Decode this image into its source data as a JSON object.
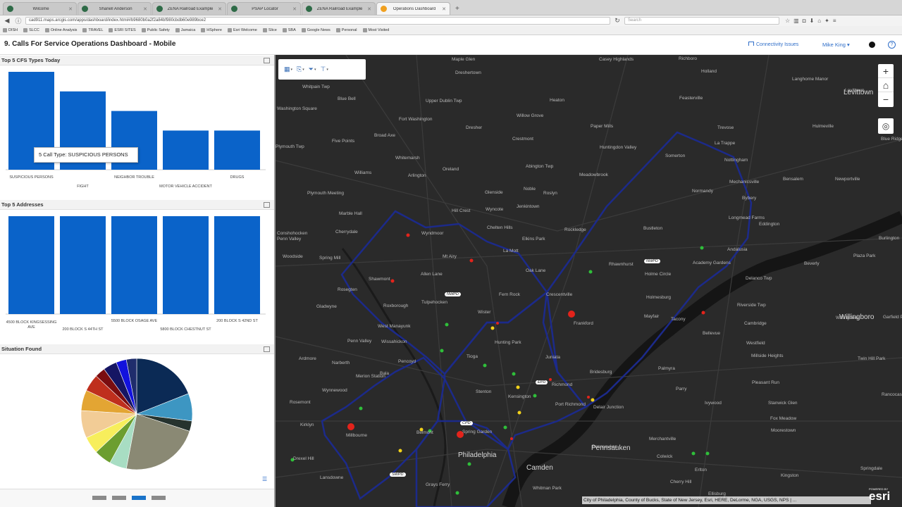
{
  "browser": {
    "tabs": [
      {
        "label": "Wilcome",
        "active": false
      },
      {
        "label": "Shanell Anderson",
        "active": false
      },
      {
        "label": "ZENA Railroad Example",
        "active": false
      },
      {
        "label": "PSAP Locator",
        "active": false
      },
      {
        "label": "ZENA Railroad Example",
        "active": false
      },
      {
        "label": "Operations Dashboard",
        "active": true
      }
    ],
    "url": "cad911.maps.arcgis.com/apps/dashboard/index.html#/b9680b0a2f2a84bf980cbdb60e989bce2",
    "search_placeholder": "Search",
    "bookmarks": [
      "DISH",
      "SLCC",
      "Online Analysis",
      "TRAVEL",
      "ESRI SITES",
      "Public Safety",
      "Jamaica",
      "HSphere",
      "Esri Welcome",
      "Slice",
      "SBA",
      "Google News",
      "Personal",
      "Most Visited"
    ]
  },
  "app": {
    "title": "9. Calls For Service Operations Dashboard - Mobile",
    "connectivity": "Connectivity Issues",
    "user": "Mike King",
    "help": "?"
  },
  "panels": {
    "cfs": {
      "title": "Top 5 CFS Types Today",
      "tooltip": "5 Call Type: SUSPICIOUS PERSONS"
    },
    "addresses": {
      "title": "Top 5 Addresses"
    },
    "situation": {
      "title": "Situation Found"
    }
  },
  "chart_data": [
    {
      "type": "bar",
      "title": "Top 5 CFS Types Today",
      "categories": [
        "SUSPICIOUS PERSONS",
        "FIGHT",
        "NEIGHBOR TROUBLE",
        "MOTOR VEHICLE ACCIDENT",
        "DRUGS"
      ],
      "values": [
        5,
        4,
        3,
        2,
        2
      ],
      "ylim": [
        0,
        5
      ],
      "color": "#0a63c9"
    },
    {
      "type": "bar",
      "title": "Top 5 Addresses",
      "categories": [
        "4500 BLOCK KINGSESSING AVE",
        "200 BLOCK S 44TH ST",
        "5500 BLOCK OSAGE AVE",
        "5800 BLOCK CHESTNUT ST",
        "200 BLOCK S 42ND ST"
      ],
      "values": [
        1,
        1,
        1,
        1,
        1
      ],
      "ylim": [
        0,
        1
      ],
      "color": "#0a63c9"
    },
    {
      "type": "pie",
      "title": "Situation Found",
      "values": [
        19,
        8,
        3,
        23,
        5,
        5,
        5,
        8,
        6,
        5,
        3,
        4,
        3,
        3
      ],
      "colors": [
        "#0b2a55",
        "#3d96c2",
        "#26332e",
        "#8a8974",
        "#a8ddc3",
        "#6c9e2f",
        "#f7ee5c",
        "#f2cc96",
        "#e3a533",
        "#bf2f1d",
        "#7a0d10",
        "#151563",
        "#1212dd",
        "#1f2d6c"
      ]
    }
  ],
  "map": {
    "places": [
      {
        "t": "Maple Glen",
        "x": 250,
        "y": 3
      },
      {
        "t": "Upper Dublin Twp",
        "x": 213,
        "y": 62
      },
      {
        "t": "Fort Washington",
        "x": 175,
        "y": 88
      },
      {
        "t": "Dresher",
        "x": 270,
        "y": 100
      },
      {
        "t": "Willow Grove",
        "x": 342,
        "y": 83
      },
      {
        "t": "Heaton",
        "x": 389,
        "y": 61
      },
      {
        "t": "Whitemarsh",
        "x": 170,
        "y": 143
      },
      {
        "t": "Arlington",
        "x": 188,
        "y": 168
      },
      {
        "t": "Oreland",
        "x": 237,
        "y": 159
      },
      {
        "t": "Crestmont",
        "x": 336,
        "y": 116
      },
      {
        "t": "Abington Twp",
        "x": 355,
        "y": 155
      },
      {
        "t": "Meadowbrook",
        "x": 431,
        "y": 167
      },
      {
        "t": "Roslyn",
        "x": 380,
        "y": 193
      },
      {
        "t": "Noble",
        "x": 352,
        "y": 187
      },
      {
        "t": "Glenside",
        "x": 297,
        "y": 192
      },
      {
        "t": "Wyncote",
        "x": 298,
        "y": 216
      },
      {
        "t": "Jenkintown",
        "x": 342,
        "y": 212
      },
      {
        "t": "Rockledge",
        "x": 410,
        "y": 245
      },
      {
        "t": "Elkins Park",
        "x": 350,
        "y": 258
      },
      {
        "t": "Chelten Hills",
        "x": 300,
        "y": 242
      },
      {
        "t": "La Mott",
        "x": 323,
        "y": 275
      },
      {
        "t": "Oak Lane",
        "x": 355,
        "y": 303
      },
      {
        "t": "Hill Crest",
        "x": 250,
        "y": 218
      },
      {
        "t": "Wyndmoor",
        "x": 207,
        "y": 250
      },
      {
        "t": "Mt Airy",
        "x": 237,
        "y": 283
      },
      {
        "t": "Allen Lane",
        "x": 206,
        "y": 308
      },
      {
        "t": "Shawmont",
        "x": 132,
        "y": 315
      },
      {
        "t": "Roxborough",
        "x": 153,
        "y": 353
      },
      {
        "t": "Tulpehocken",
        "x": 207,
        "y": 348
      },
      {
        "t": "Fern Rock",
        "x": 317,
        "y": 337
      },
      {
        "t": "Crescentville",
        "x": 384,
        "y": 337
      },
      {
        "t": "Wister",
        "x": 287,
        "y": 362
      },
      {
        "t": "Frankford",
        "x": 423,
        "y": 378
      },
      {
        "t": "Hunting Park",
        "x": 311,
        "y": 405
      },
      {
        "t": "Tioga",
        "x": 271,
        "y": 425
      },
      {
        "t": "Juniata",
        "x": 383,
        "y": 426
      },
      {
        "t": "Kensington",
        "x": 330,
        "y": 482
      },
      {
        "t": "Richmond",
        "x": 392,
        "y": 465
      },
      {
        "t": "Port Richmond",
        "x": 397,
        "y": 493
      },
      {
        "t": "Delair Junction",
        "x": 451,
        "y": 497
      },
      {
        "t": "Stenton",
        "x": 284,
        "y": 475
      },
      {
        "t": "Spring Garden",
        "x": 265,
        "y": 532
      },
      {
        "t": "Belmont",
        "x": 200,
        "y": 533
      },
      {
        "t": "Wissahickon",
        "x": 150,
        "y": 404
      },
      {
        "t": "Pencoyd",
        "x": 174,
        "y": 432
      },
      {
        "t": "West Manayunk",
        "x": 145,
        "y": 382
      },
      {
        "t": "Bala",
        "x": 148,
        "y": 449
      },
      {
        "t": "Narberth",
        "x": 80,
        "y": 434
      },
      {
        "t": "Merion Station",
        "x": 114,
        "y": 453
      },
      {
        "t": "Wynnewood",
        "x": 66,
        "y": 473
      },
      {
        "t": "Penn Valley",
        "x": 102,
        "y": 403
      },
      {
        "t": "Ardmore",
        "x": 33,
        "y": 428
      },
      {
        "t": "Gladwyne",
        "x": 58,
        "y": 354
      },
      {
        "t": "Rosemont",
        "x": 20,
        "y": 490
      },
      {
        "t": "Kirklyn",
        "x": 35,
        "y": 522
      },
      {
        "t": "Millbourne",
        "x": 100,
        "y": 537
      },
      {
        "t": "Drexel Hill",
        "x": 25,
        "y": 570
      },
      {
        "t": "Lansdowne",
        "x": 63,
        "y": 597
      },
      {
        "t": "Grays Ferry",
        "x": 213,
        "y": 607
      },
      {
        "t": "Whitman Park",
        "x": 365,
        "y": 612
      },
      {
        "t": "Spring Mill",
        "x": 62,
        "y": 285
      },
      {
        "t": "Rosegten",
        "x": 88,
        "y": 330
      },
      {
        "t": "Conshohocken",
        "x": 2,
        "y": 250
      },
      {
        "t": "Cherrydale",
        "x": 85,
        "y": 248
      },
      {
        "t": "Marble Hall",
        "x": 90,
        "y": 222
      },
      {
        "t": "Plymouth Meeting",
        "x": 45,
        "y": 193
      },
      {
        "t": "Williams",
        "x": 112,
        "y": 164
      },
      {
        "t": "Broad Axe",
        "x": 140,
        "y": 111
      },
      {
        "t": "Five Points",
        "x": 80,
        "y": 119
      },
      {
        "t": "Blue Bell",
        "x": 88,
        "y": 59
      },
      {
        "t": "Washington Square",
        "x": 2,
        "y": 73
      },
      {
        "t": "Whitpain Twp",
        "x": 38,
        "y": 42
      },
      {
        "t": "Plymouth Twp",
        "x": 0,
        "y": 127
      },
      {
        "t": "Woodside",
        "x": 10,
        "y": 283
      },
      {
        "t": "Dreshertown",
        "x": 255,
        "y": 22
      },
      {
        "t": "Huntingdon Valley",
        "x": 460,
        "y": 128
      },
      {
        "t": "Paper Mills",
        "x": 447,
        "y": 98
      },
      {
        "t": "Feasterville",
        "x": 573,
        "y": 58
      },
      {
        "t": "Trevose",
        "x": 627,
        "y": 100
      },
      {
        "t": "Holland",
        "x": 604,
        "y": 20
      },
      {
        "t": "Richboro",
        "x": 572,
        "y": 2
      },
      {
        "t": "Casey Highlands",
        "x": 459,
        "y": 3
      },
      {
        "t": "Somerton",
        "x": 553,
        "y": 140
      },
      {
        "t": "La Trappe",
        "x": 623,
        "y": 122
      },
      {
        "t": "Nottingham",
        "x": 637,
        "y": 146
      },
      {
        "t": "Mechanicsville",
        "x": 644,
        "y": 177
      },
      {
        "t": "Normandy",
        "x": 591,
        "y": 190
      },
      {
        "t": "Bybery",
        "x": 662,
        "y": 200
      },
      {
        "t": "Longmead Farms",
        "x": 643,
        "y": 228
      },
      {
        "t": "Eddington",
        "x": 686,
        "y": 237
      },
      {
        "t": "Bustleton",
        "x": 522,
        "y": 243
      },
      {
        "t": "Andalusia",
        "x": 641,
        "y": 273
      },
      {
        "t": "Academy Gardens",
        "x": 592,
        "y": 292
      },
      {
        "t": "Holme Circle",
        "x": 524,
        "y": 308
      },
      {
        "t": "Rhawnhurst",
        "x": 473,
        "y": 294
      },
      {
        "t": "Holmesburg",
        "x": 526,
        "y": 341
      },
      {
        "t": "Mayfair",
        "x": 523,
        "y": 368
      },
      {
        "t": "Tacony",
        "x": 561,
        "y": 372
      },
      {
        "t": "Delanco Twp",
        "x": 667,
        "y": 314
      },
      {
        "t": "Riverside Twp",
        "x": 655,
        "y": 352
      },
      {
        "t": "Cambridge",
        "x": 665,
        "y": 378
      },
      {
        "t": "Bellevue",
        "x": 606,
        "y": 392
      },
      {
        "t": "Palmyra",
        "x": 543,
        "y": 442
      },
      {
        "t": "Bridesburg",
        "x": 446,
        "y": 447
      },
      {
        "t": "Parry",
        "x": 568,
        "y": 471
      },
      {
        "t": "Pleasant Run",
        "x": 676,
        "y": 462
      },
      {
        "t": "Millside Heights",
        "x": 675,
        "y": 424
      },
      {
        "t": "Westfield",
        "x": 668,
        "y": 406
      },
      {
        "t": "Ivywood",
        "x": 609,
        "y": 491
      },
      {
        "t": "Stanwick Glen",
        "x": 699,
        "y": 491
      },
      {
        "t": "Fox Meadow",
        "x": 702,
        "y": 513
      },
      {
        "t": "Moorestown",
        "x": 703,
        "y": 530
      },
      {
        "t": "Pennsauken",
        "x": 449,
        "y": 553
      },
      {
        "t": "Colwick",
        "x": 541,
        "y": 567
      },
      {
        "t": "Merchantville",
        "x": 530,
        "y": 542
      },
      {
        "t": "Cherry Hill",
        "x": 560,
        "y": 603
      },
      {
        "t": "Erlton",
        "x": 595,
        "y": 586
      },
      {
        "t": "Ellisburg",
        "x": 614,
        "y": 620
      },
      {
        "t": "Kingston",
        "x": 717,
        "y": 594
      },
      {
        "t": "Springdale",
        "x": 830,
        "y": 584
      },
      {
        "t": "Levittown",
        "x": 808,
        "y": 47
      },
      {
        "t": "Langhorne Manor",
        "x": 733,
        "y": 31
      },
      {
        "t": "Hulmeville",
        "x": 762,
        "y": 98
      },
      {
        "t": "Bensalem",
        "x": 720,
        "y": 173
      },
      {
        "t": "Newportville",
        "x": 794,
        "y": 173
      },
      {
        "t": "Blue Ridge",
        "x": 859,
        "y": 116
      },
      {
        "t": "Beverly",
        "x": 750,
        "y": 293
      },
      {
        "t": "Burlington",
        "x": 856,
        "y": 257
      },
      {
        "t": "Plaza Park",
        "x": 820,
        "y": 282
      },
      {
        "t": "Willingboro",
        "x": 795,
        "y": 370
      },
      {
        "t": "Garfield Park",
        "x": 862,
        "y": 369
      },
      {
        "t": "Twin Hill Park",
        "x": 826,
        "y": 428
      },
      {
        "t": "Rancocas Woods",
        "x": 860,
        "y": 479
      },
      {
        "t": "Penn Valley",
        "x": 2,
        "y": 258
      }
    ],
    "big_places": [
      {
        "t": "Philadelphia",
        "x": 259,
        "y": 563
      },
      {
        "t": "Camden",
        "x": 356,
        "y": 581
      },
      {
        "t": "Willingboro",
        "x": 800,
        "y": 367
      },
      {
        "t": "Levittown",
        "x": 806,
        "y": 48
      },
      {
        "t": "Pennsauken",
        "x": 448,
        "y": 553
      }
    ],
    "district_badges": [
      {
        "t": "NWPD",
        "x": 240,
        "y": 337
      },
      {
        "t": "NWPD",
        "x": 523,
        "y": 290
      },
      {
        "t": "EPD",
        "x": 369,
        "y": 462
      },
      {
        "t": "CPD",
        "x": 262,
        "y": 520
      },
      {
        "t": "SWPD",
        "x": 162,
        "y": 593
      }
    ],
    "attribution": "City of Philadelphia, County of Bucks, State of New Jersey, Esri, HERE, DeLorme, NGA, USGS, NPS | ...",
    "esri_powered": "POWERED BY",
    "esri_logo": "esri",
    "zoom_in": "+",
    "zoom_out": "−",
    "home": "⌂",
    "locate": "◎"
  }
}
